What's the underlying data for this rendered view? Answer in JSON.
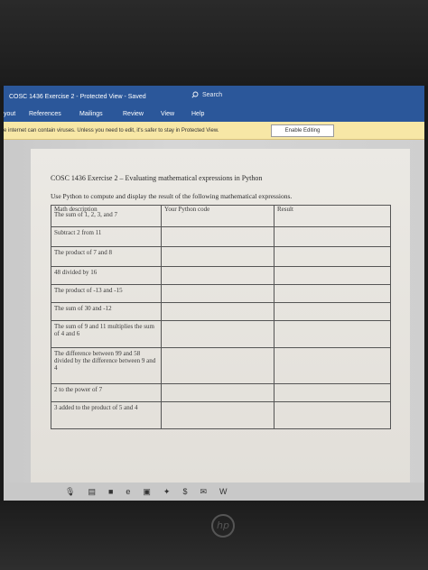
{
  "window": {
    "title": "COSC 1436 Exercise 2  -  Protected View  -  Saved",
    "search_label": "Search"
  },
  "ribbon": {
    "tabs": [
      "yout",
      "References",
      "Mailings",
      "Review",
      "View",
      "Help"
    ]
  },
  "protected_view": {
    "message": "e internet can contain viruses. Unless you need to edit, it's safer to stay in Protected View.",
    "enable_button": "Enable Editing"
  },
  "document": {
    "heading": "COSC 1436 Exercise 2 – Evaluating mathematical expressions in Python",
    "instructions": "Use Python to compute and display the result of the following mathematical expressions.",
    "table": {
      "columns": [
        "Math description",
        "Your Python code",
        "Result"
      ],
      "rows": [
        "The sum of 1, 2, 3, and 7",
        "Subtract 2 from 11",
        "The product of 7 and 8",
        "48 divided by 16",
        "The product of -13 and -15",
        "The sum of 30 and -12",
        "The sum of 9 and 11 multiplies the sum of 4 and 6",
        "The difference between 99 and 58 divided by the difference between 9 and 4",
        "2 to the power of 7",
        "3 added to the product of 5 and 4"
      ]
    }
  },
  "taskbar": {
    "icons": [
      "microphone-icon",
      "task-view-icon",
      "file-explorer-icon",
      "edge-icon",
      "store-icon",
      "dropbox-icon",
      "app-icon",
      "mail-icon",
      "word-icon"
    ]
  },
  "device": {
    "logo_text": "hp"
  }
}
